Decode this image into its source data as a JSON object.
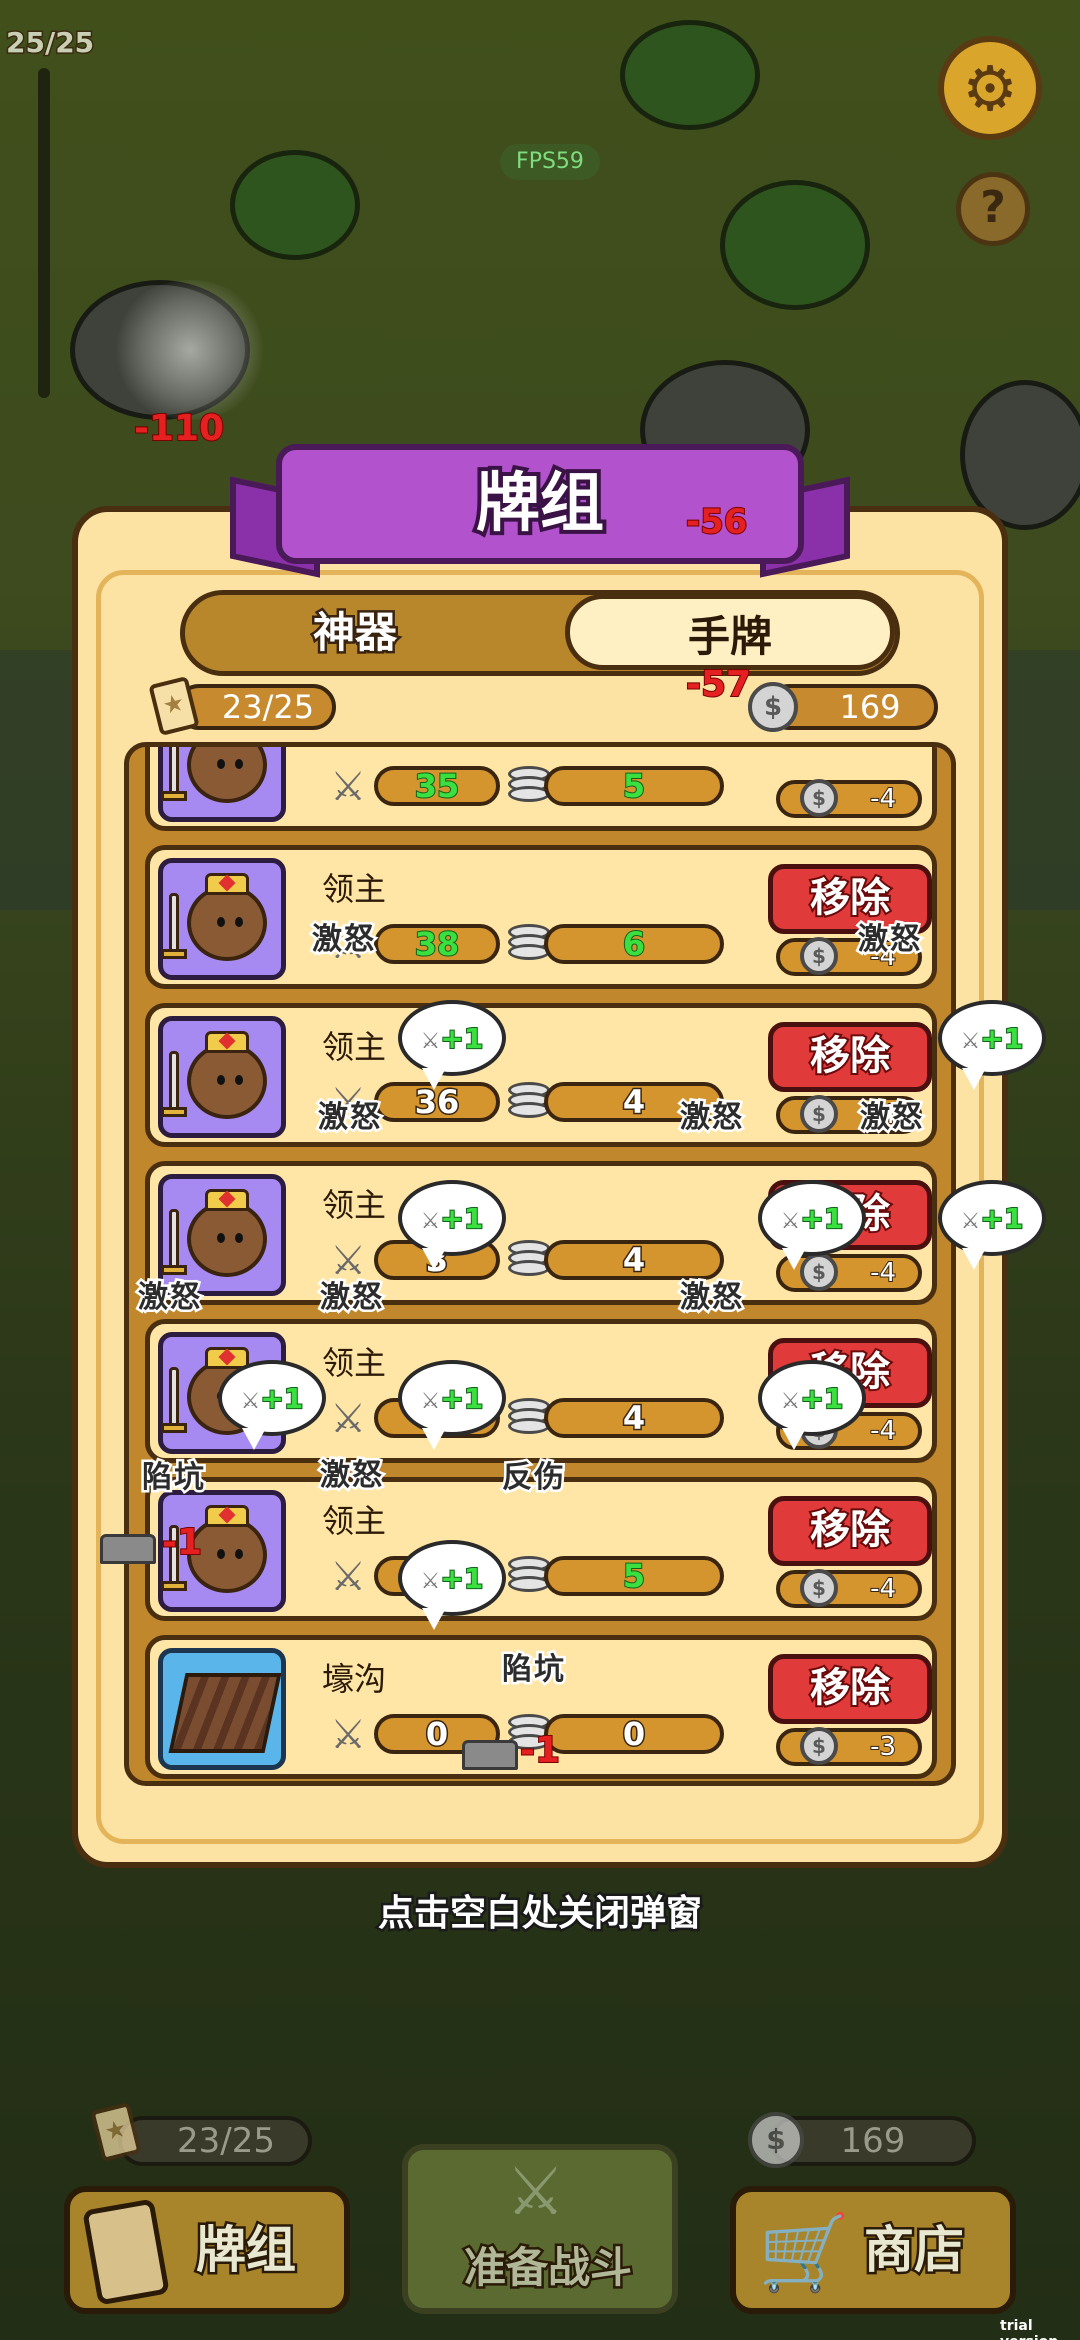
{
  "hud": {
    "unit_count": "25/25",
    "fps": "FPS59",
    "settings_icon": "gear-icon",
    "help_label": "?",
    "damage": [
      "-110",
      "-56",
      "-57"
    ]
  },
  "deck_panel": {
    "title": "牌组",
    "tabs": [
      {
        "label": "神器",
        "active": false
      },
      {
        "label": "手牌",
        "active": true
      }
    ],
    "card_count": "23/25",
    "coins": "169",
    "rows": [
      {
        "name": "",
        "attack": "35",
        "attack_buffed": true,
        "cost": "5",
        "cost_buffed": true,
        "remove_label": "",
        "refund": "-4"
      },
      {
        "name": "领主",
        "attack": "38",
        "attack_buffed": true,
        "cost": "6",
        "cost_buffed": true,
        "remove_label": "移除",
        "refund": "-4"
      },
      {
        "name": "领主",
        "attack": "36",
        "attack_buffed": false,
        "cost": "4",
        "cost_buffed": false,
        "remove_label": "移除",
        "refund": "-4"
      },
      {
        "name": "领主",
        "attack": "3",
        "attack_buffed": false,
        "cost": "4",
        "cost_buffed": false,
        "remove_label": "移除",
        "refund": "-4"
      },
      {
        "name": "领主",
        "attack": "",
        "attack_buffed": false,
        "cost": "4",
        "cost_buffed": false,
        "remove_label": "移除",
        "refund": "-4"
      },
      {
        "name": "领主",
        "attack": "",
        "attack_buffed": false,
        "cost": "5",
        "cost_buffed": true,
        "remove_label": "移除",
        "refund": "-4"
      },
      {
        "name": "壕沟",
        "attack": "0",
        "attack_buffed": false,
        "cost": "0",
        "cost_buffed": false,
        "remove_label": "移除",
        "refund": "-3"
      }
    ],
    "effects": {
      "rage": "激怒",
      "trap": "陷坑",
      "reflect": "反伤",
      "buff": "+1",
      "minus": "-1"
    },
    "close_hint": "点击空白处关闭弹窗"
  },
  "bottom_bar": {
    "card_count": "23/25",
    "coins": "169",
    "deck_button": "牌组",
    "battle_button": "准备战斗",
    "shop_button": "商店"
  },
  "watermark": "trial version",
  "colors": {
    "ribbon": "#b252cc",
    "remove_button": "#e03a3a",
    "panel": "#fce3a4",
    "buff_text": "#3ae040"
  }
}
